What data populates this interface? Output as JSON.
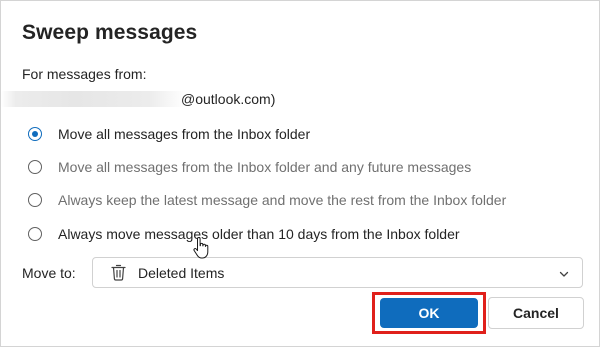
{
  "dialog": {
    "title": "Sweep messages",
    "from_label": "For messages from:",
    "sender_email_visible": "@outlook.com)",
    "options": [
      {
        "label": "Move all messages from the Inbox folder",
        "selected": true
      },
      {
        "label": "Move all messages from the Inbox folder and any future messages",
        "selected": false
      },
      {
        "label": "Always keep the latest message and move the rest from the Inbox folder",
        "selected": false
      },
      {
        "label": "Always move messages older than 10 days from the Inbox folder",
        "selected": false
      }
    ],
    "move_to_label": "Move to:",
    "move_to_value": "Deleted Items",
    "move_to_icon": "trash-icon",
    "ok_label": "OK",
    "cancel_label": "Cancel"
  },
  "colors": {
    "accent": "#0f6cbd",
    "highlight_box": "#e0201b"
  }
}
